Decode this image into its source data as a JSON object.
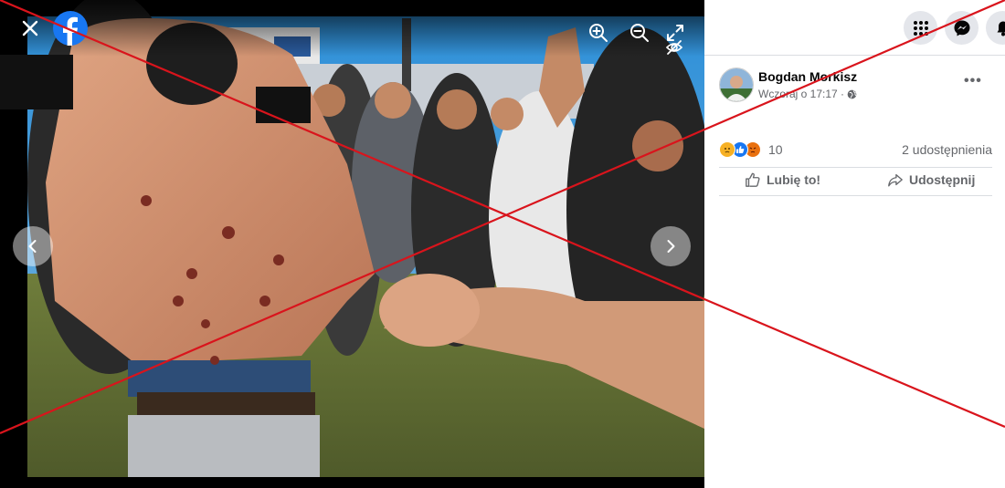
{
  "viewer": {
    "photo_alt": "Shirtless man with wounds on his back surrounded by a crowd",
    "icons": {
      "close": "close-icon",
      "logo": "facebook-logo-icon",
      "zoom_in": "zoom-in-icon",
      "zoom_out": "zoom-out-icon",
      "fullscreen": "fullscreen-icon",
      "prev": "chevron-left-icon",
      "next": "chevron-right-icon"
    }
  },
  "post": {
    "author": "Bogdan Morkisz",
    "timestamp": "Wczoraj o 17:17 ·",
    "privacy_icon": "globe-icon",
    "more_label": "•••",
    "reaction_count": "10",
    "reaction_types": [
      "sad",
      "like",
      "angry"
    ],
    "shares": "2 udostępnienia",
    "like_label": "Lubię to!",
    "share_label": "Udostępnij"
  },
  "colors": {
    "facebook_blue": "#1877f2",
    "strike_red": "#d9141c"
  }
}
